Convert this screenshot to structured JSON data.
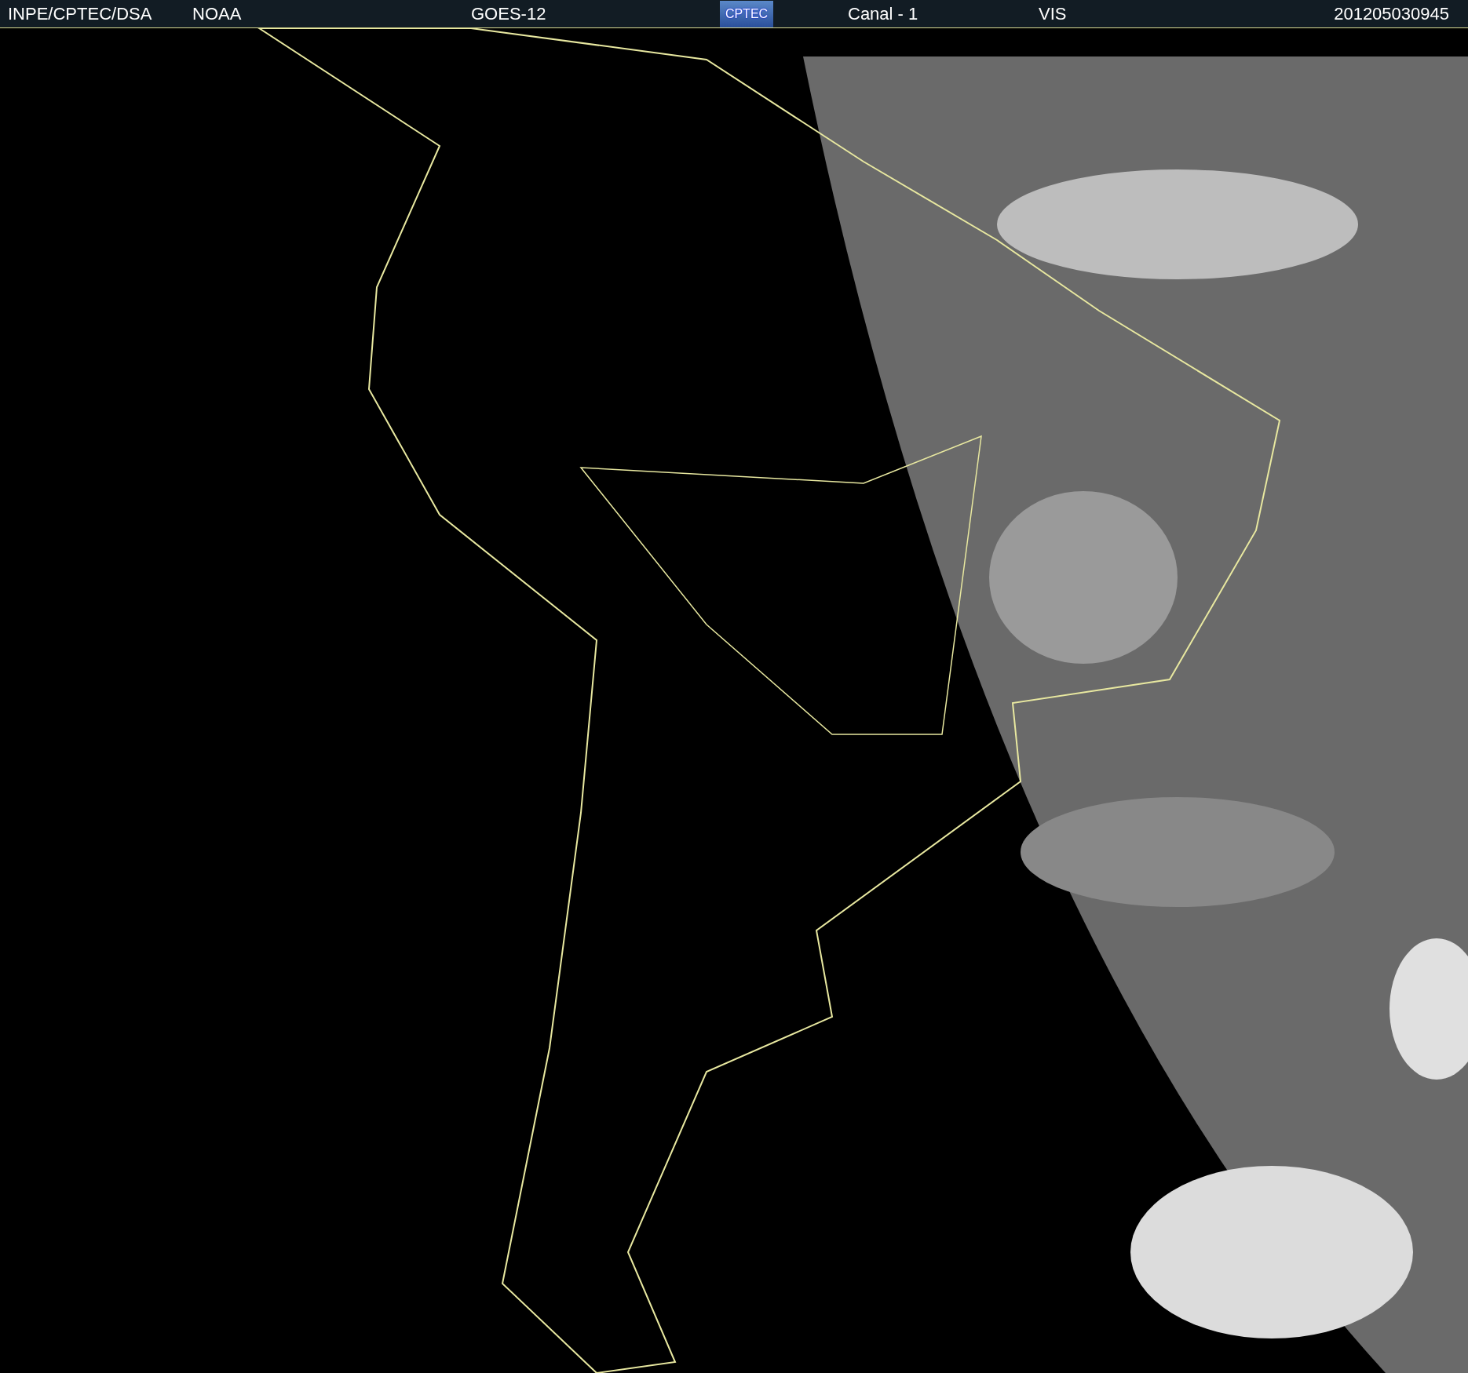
{
  "header": {
    "source": "INPE/CPTEC/DSA",
    "agency": "NOAA",
    "satellite": "GOES-12",
    "logo_text": "CPTEC",
    "channel": "Canal - 1",
    "band": "VIS",
    "timestamp": "201205030945"
  }
}
